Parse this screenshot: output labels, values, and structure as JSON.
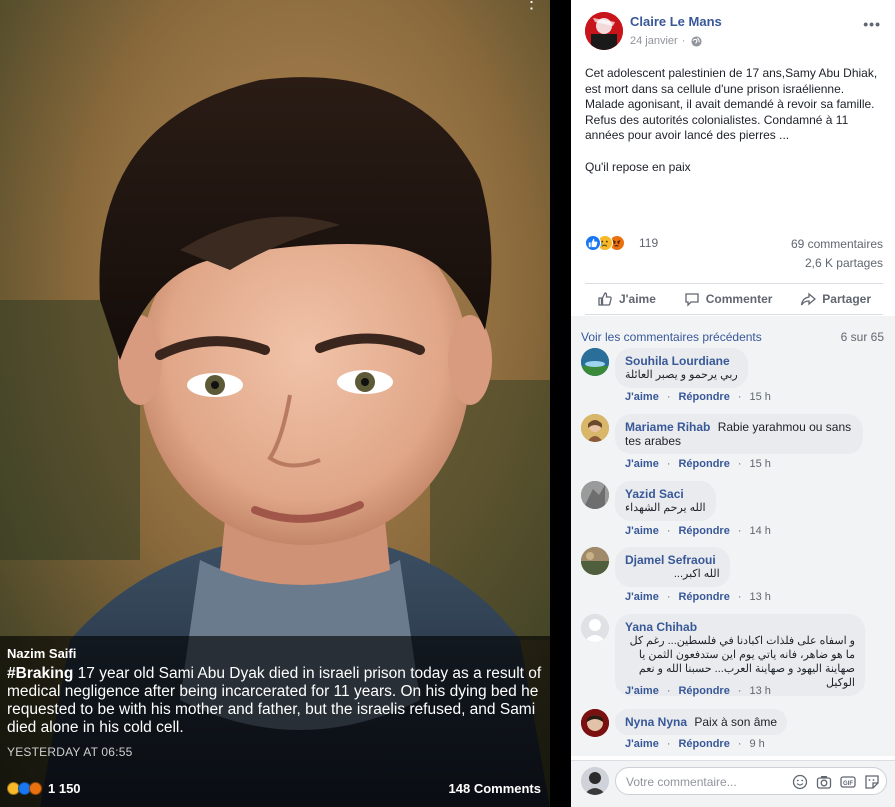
{
  "viewer": {
    "caption": {
      "author": "Nazim Saifi",
      "hashtag": "#Braking",
      "text": " 17 year old Sami Abu Dyak died in israeli prison today  as a result of medical negligence after being incarcerated for 11 years.  On his dying bed he requested to be with his mother and father,  but the israelis refused, and Sami died alone in his cold cell.",
      "time": "YESTERDAY AT 06:55",
      "reaction_count": "1 150",
      "comment_count": "148 Comments"
    }
  },
  "post": {
    "page_name": "Claire Le Mans",
    "date": "24 janvier",
    "body_lines": [
      "Cet adolescent palestinien de 17 ans,Samy Abu Dhiak, est mort dans sa cellule d'une prison israélienne. Malade agonisant, il avait demandé à revoir sa famille. Refus des autorités colonialistes. Condamné à 11 années pour avoir lancé des pierres ..."
    ],
    "closing": "Qu'il repose en paix",
    "reaction_count": "119",
    "comments_count": "69 commentaires",
    "shares_count": "2,6 K partages",
    "actions": {
      "like": "J'aime",
      "comment": "Commenter",
      "share": "Partager"
    },
    "colors": {
      "link": "#385898",
      "like_blue": "#1877f2",
      "sad_yellow": "#f7b928",
      "angry_orange": "#e9710f"
    }
  },
  "comments_header": {
    "previous": "Voir les commentaires précédents",
    "pager": "6 sur 65"
  },
  "comments": [
    {
      "author": "Souhila Lourdiane",
      "text": "ربي يرحمو و يصبر العائلة",
      "like": "J'aime",
      "reply": "Répondre",
      "time": "15 h"
    },
    {
      "author": "Mariame Rihab",
      "text": "Rabie yarahmou ou sans tes arabes",
      "like": "J'aime",
      "reply": "Répondre",
      "time": "15 h"
    },
    {
      "author": "Yazid Saci",
      "text": "الله يرحم الشهداء",
      "like": "J'aime",
      "reply": "Répondre",
      "time": "14 h"
    },
    {
      "author": "Djamel Sefraoui",
      "text": "الله اكبر...",
      "like": "J'aime",
      "reply": "Répondre",
      "time": "13 h"
    },
    {
      "author": "Yana Chihab",
      "text": "و اسفاه على فلذات اكبادنا في فلسطين... رغم كل ما هو ضاهر، فانه ياتي يوم اين ستدفعون الثمن يا صهاينة اليهود و صهاينة العرب... حسبنا الله و نعم الوكيل",
      "like": "J'aime",
      "reply": "Répondre",
      "time": "13 h"
    },
    {
      "author": "Nyna Nyna",
      "text": "Paix à son âme",
      "like": "J'aime",
      "reply": "Répondre",
      "time": "9 h"
    }
  ],
  "composer": {
    "placeholder": "Votre commentaire..."
  }
}
